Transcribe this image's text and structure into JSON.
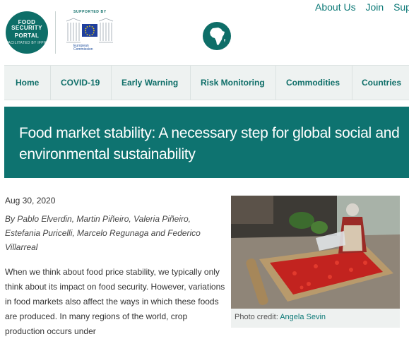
{
  "brand": {
    "logo_line1": "FOOD",
    "logo_line2": "SECURITY",
    "logo_line3": "PORTAL",
    "logo_line4": "FACILITATED BY",
    "logo_line5": "IFPRI",
    "supported_by": "SUPPORTED BY",
    "ec_line1": "European",
    "ec_line2": "Commission"
  },
  "topnav": {
    "about": "About Us",
    "join": "Join",
    "support": "Support"
  },
  "mainnav": [
    "Home",
    "COVID-19",
    "Early Warning",
    "Risk Monitoring",
    "Commodities",
    "Countries"
  ],
  "article": {
    "title": "Food market stability: A necessary step for global social and environmental sustainability",
    "date": "Aug 30, 2020",
    "byline": "By Pablo Elverdin, Martin Piñeiro, Valeria Piñeiro, Estefania Puricelli, Marcelo Regunaga and Federico Villarreal",
    "body": "When we think about food price stability, we typically only think about its impact on food security. However, variations in food markets also affect the ways in which these foods are produced. In many regions of the world, crop production occurs under"
  },
  "photo": {
    "credit_label": "Photo credit:",
    "credit_name": "Angela Sevin"
  },
  "colors": {
    "brand_teal": "#0e7370",
    "link": "#0e7a78",
    "nav_bg": "#eef2f1"
  }
}
